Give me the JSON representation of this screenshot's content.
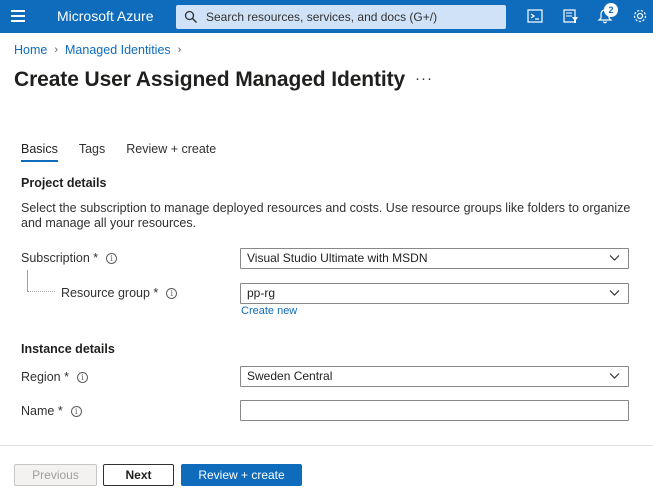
{
  "topbar": {
    "brand": "Microsoft Azure",
    "search_placeholder": "Search resources, services, and docs (G+/)",
    "notifications_count": "2",
    "icons": [
      "menu-icon",
      "search-icon",
      "cloud-shell-icon",
      "directory-filter-icon",
      "notifications-icon",
      "settings-icon"
    ],
    "accent_color": "#0f6cbd"
  },
  "breadcrumb": {
    "home": "Home",
    "parent": "Managed Identities"
  },
  "page": {
    "title": "Create User Assigned Managed Identity",
    "more_label": "···"
  },
  "tabs": [
    {
      "label": "Basics",
      "active": true
    },
    {
      "label": "Tags",
      "active": false
    },
    {
      "label": "Review + create",
      "active": false
    }
  ],
  "project": {
    "heading": "Project details",
    "description": "Select the subscription to manage deployed resources and costs. Use resource groups like folders to organize and manage all your resources.",
    "subscription_label": "Subscription *",
    "subscription_value": "Visual Studio Ultimate with MSDN",
    "resource_group_label": "Resource group *",
    "resource_group_value": "pp-rg",
    "create_new": "Create new"
  },
  "instance": {
    "heading": "Instance details",
    "region_label": "Region *",
    "region_value": "Sweden Central",
    "name_label": "Name *",
    "name_value": ""
  },
  "footer": {
    "previous": "Previous",
    "next": "Next",
    "review_create": "Review + create"
  }
}
